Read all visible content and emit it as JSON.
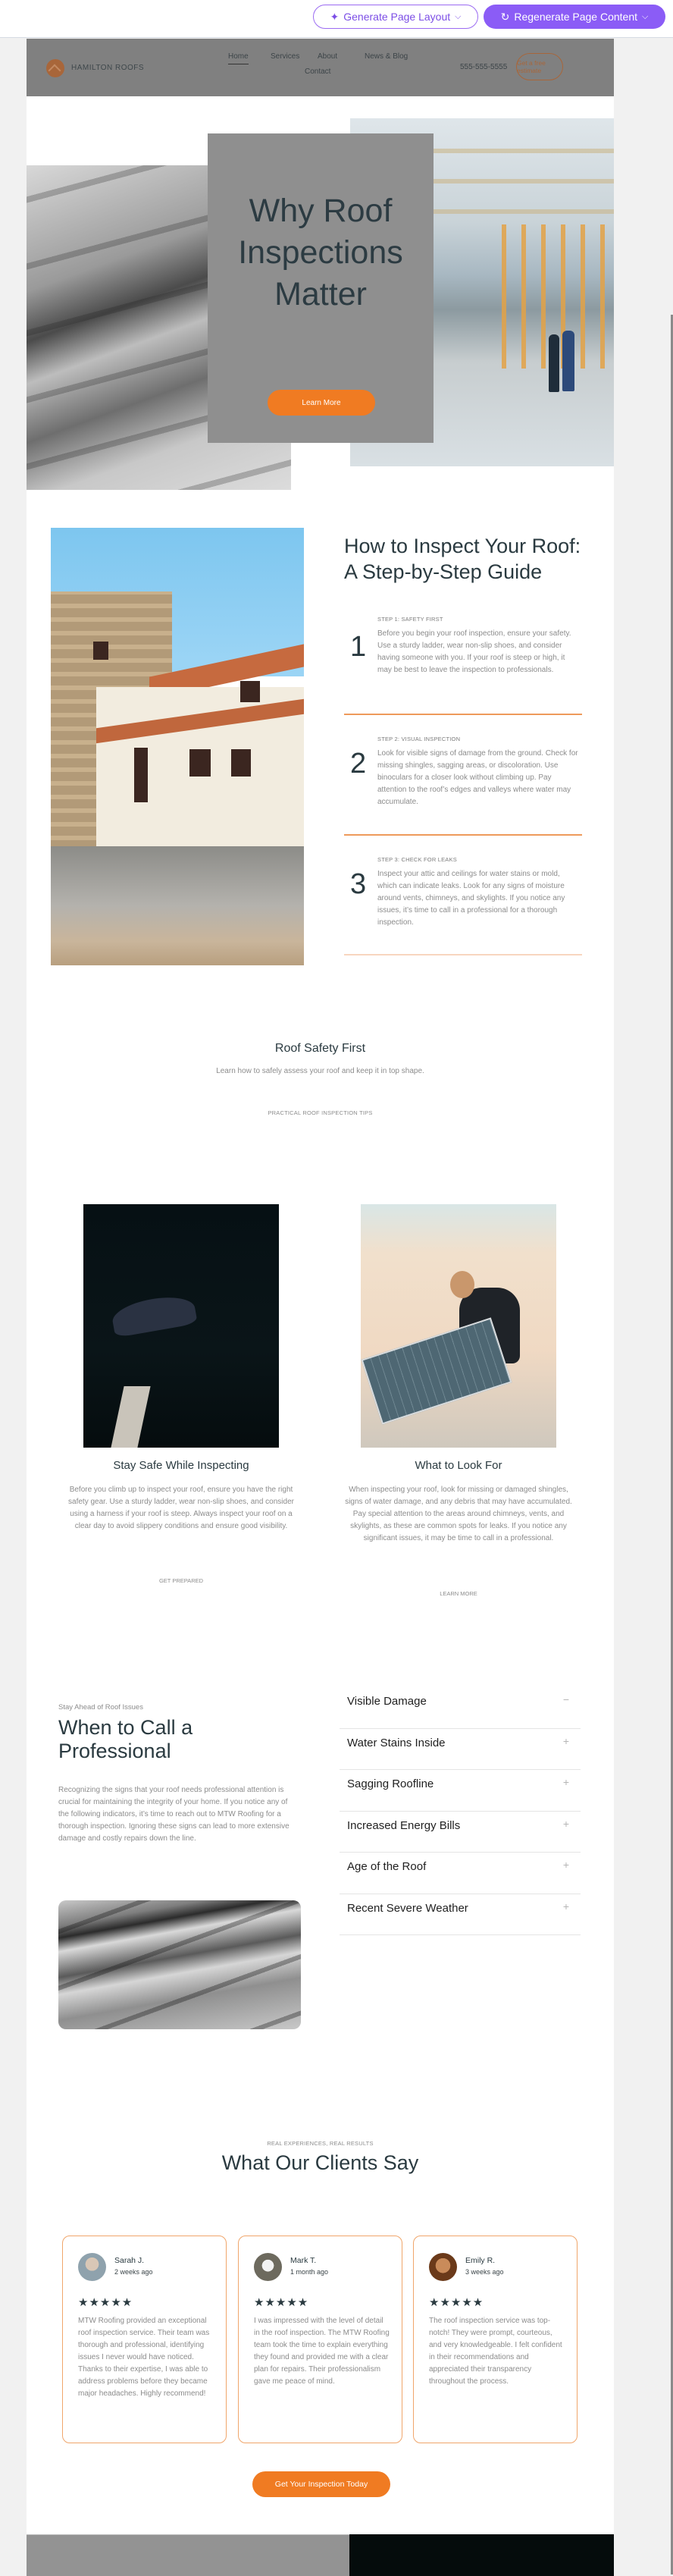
{
  "toolbar": {
    "generate_layout": "Generate Page Layout",
    "regenerate_content": "Regenerate Page Content",
    "sparkle_icon": "sparkle-icon",
    "refresh_icon": "refresh-icon",
    "chevron": "⌄"
  },
  "nav": {
    "brand": "HAMILTON ROOFS",
    "links": [
      "Home",
      "Services",
      "About",
      "News & Blog",
      "Contact"
    ],
    "active": "Home",
    "phone": "555-555-5555",
    "cta": "Get a free estimate"
  },
  "hero": {
    "title_lines": [
      "Why Roof",
      "Inspections",
      "Matter"
    ],
    "button": "Learn More"
  },
  "guide": {
    "title_lines": [
      "How to Inspect Your Roof:",
      "A Step-by-Step Guide"
    ],
    "steps": [
      {
        "num": "1",
        "label": "STEP 1: SAFETY FIRST",
        "body": "Before you begin your roof inspection, ensure your safety. Use a sturdy ladder, wear non-slip shoes, and consider having someone with you. If your roof is steep or high, it may be best to leave the inspection to professionals."
      },
      {
        "num": "2",
        "label": "STEP 2: VISUAL INSPECTION",
        "body": "Look for visible signs of damage from the ground. Check for missing shingles, sagging areas, or discoloration. Use binoculars for a closer look without climbing up. Pay attention to the roof’s edges and valleys where water may accumulate."
      },
      {
        "num": "3",
        "label": "STEP 3: CHECK FOR LEAKS",
        "body": "Inspect your attic and ceilings for water stains or mold, which can indicate leaks. Look for any signs of moisture around vents, chimneys, and skylights. If you notice any issues, it’s time to call in a professional for a thorough inspection."
      }
    ]
  },
  "safety": {
    "title": "Roof Safety First",
    "subtitle": "Learn how to safely assess your roof and keep it in top shape.",
    "eyebrow": "PRACTICAL ROOF INSPECTION TIPS",
    "columns": [
      {
        "title": "Stay Safe While Inspecting",
        "body": "Before you climb up to inspect your roof, ensure you have the right safety gear. Use a sturdy ladder, wear non-slip shoes, and consider using a harness if your roof is steep. Always inspect your roof on a clear day to avoid slippery conditions and ensure good visibility.",
        "link": "GET PREPARED"
      },
      {
        "title": "What to Look For",
        "body": "When inspecting your roof, look for missing or damaged shingles, signs of water damage, and any debris that may have accumulated. Pay special attention to the areas around chimneys, vents, and skylights, as these are common spots for leaks. If you notice any significant issues, it may be time to call in a professional.",
        "link": "LEARN MORE"
      }
    ]
  },
  "when_to_call": {
    "eyebrow": "Stay Ahead of Roof Issues",
    "title_lines": [
      "When to Call a",
      "Professional"
    ],
    "body": "Recognizing the signs that your roof needs professional attention is crucial for maintaining the integrity of your home. If you notice any of the following indicators, it’s time to reach out to MTW Roofing for a thorough inspection. Ignoring these signs can lead to more extensive damage and costly repairs down the line.",
    "accordion": [
      {
        "label": "Visible Damage",
        "icon": "−",
        "expanded": true
      },
      {
        "label": "Water Stains Inside",
        "icon": "+",
        "expanded": false
      },
      {
        "label": "Sagging Roofline",
        "icon": "+",
        "expanded": false
      },
      {
        "label": "Increased Energy Bills",
        "icon": "+",
        "expanded": false
      },
      {
        "label": "Age of the Roof",
        "icon": "+",
        "expanded": false
      },
      {
        "label": "Recent Severe Weather",
        "icon": "+",
        "expanded": false
      }
    ]
  },
  "testimonials": {
    "eyebrow": "REAL EXPERIENCES, REAL RESULTS",
    "title": "What Our Clients Say",
    "items": [
      {
        "name": "Sarah J.",
        "time": "2 weeks ago",
        "stars": "★★★★★",
        "rating": 5,
        "body": "MTW Roofing provided an exceptional roof inspection service. Their team was thorough and professional, identifying issues I never would have noticed. Thanks to their expertise, I was able to address problems before they became major headaches. Highly recommend!"
      },
      {
        "name": "Mark T.",
        "time": "1 month ago",
        "stars": "★★★★★",
        "rating": 5,
        "body": "I was impressed with the level of detail in the roof inspection. The MTW Roofing team took the time to explain everything they found and provided me with a clear plan for repairs. Their professionalism gave me peace of mind."
      },
      {
        "name": "Emily R.",
        "time": "3 weeks ago",
        "stars": "★★★★★",
        "rating": 5,
        "body": "The roof inspection service was top-notch! They were prompt, courteous, and very knowledgeable. I felt confident in their recommendations and appreciated their transparency throughout the process."
      }
    ],
    "cta": "Get Your Inspection Today"
  },
  "colors": {
    "accent_orange": "#f07b22",
    "brand_purple": "#8b5cf6",
    "heading": "#2a3a40",
    "body_text": "#8c8c8c",
    "nav_bg": "#808080"
  }
}
